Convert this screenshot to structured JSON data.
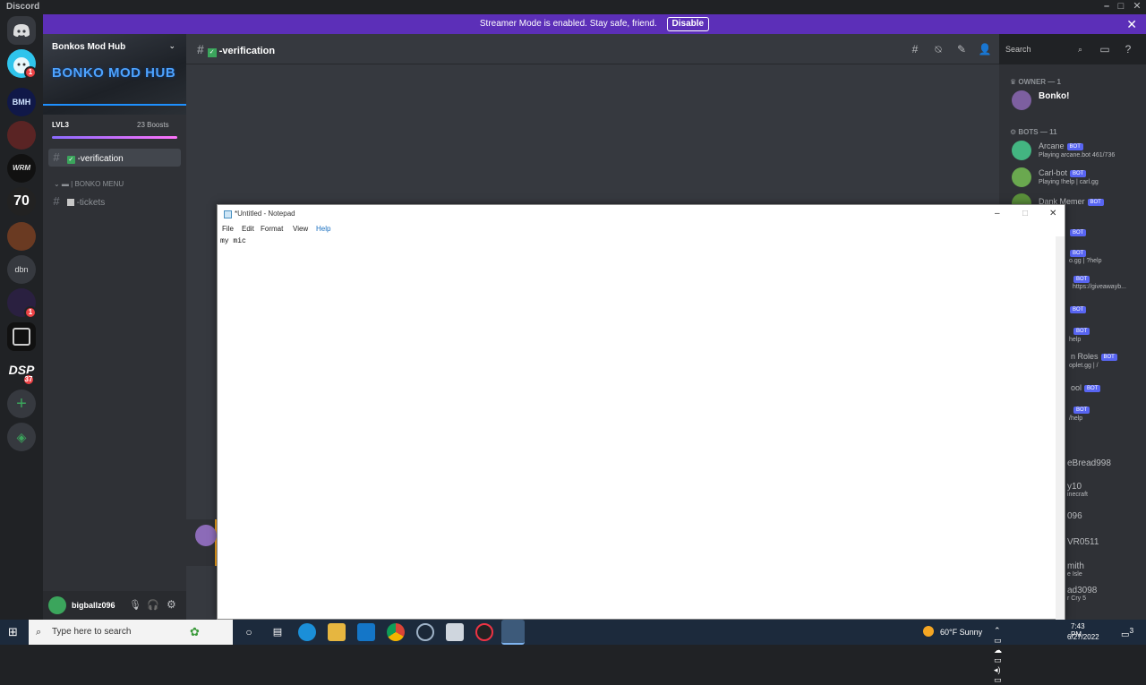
{
  "app": {
    "title": "Discord"
  },
  "streamer": {
    "message": "Streamer Mode is enabled. Stay safe, friend.",
    "button": "Disable"
  },
  "guilds": [
    {
      "label": "BMH",
      "badge": ""
    },
    {
      "label": "WRM",
      "badge": ""
    },
    {
      "label": "70",
      "badge": ""
    },
    {
      "label": "dbn",
      "badge": ""
    },
    {
      "label": "DSP",
      "badge": "37"
    }
  ],
  "guild_badges": {
    "second": "1",
    "purple": "1"
  },
  "server": {
    "name": "Bonkos Mod Hub",
    "banner_text": "BONKO MOD HUB",
    "level": "LVL3",
    "boosts": "23 Boosts",
    "active_channel": "-verification",
    "category": "| BONKO MENU",
    "channels": [
      "-tickets"
    ]
  },
  "chat": {
    "channel": "-verification",
    "search_placeholder": "Search"
  },
  "members": {
    "owner_cat": "OWNER — 1",
    "owner_name": "Bonko!",
    "bots_cat": "BOTS — 11",
    "bot_badge": "BOT",
    "bots": [
      {
        "name": "Arcane",
        "sub": "Playing arcane.bot 461/736"
      },
      {
        "name": "Carl-bot",
        "sub": "Playing !help | carl.gg"
      },
      {
        "name": "Dank Memer",
        "sub": ""
      }
    ],
    "partial": [
      "o.gg | ?help",
      "https://giveawayb...",
      "help",
      "n Roles",
      "oplet.gg | /",
      "ool",
      "/help",
      "eBread998",
      "y10",
      "inecraft",
      "096",
      "VR0511",
      "mith",
      "e Isle",
      "ad3098",
      "r Cry 5"
    ]
  },
  "user": {
    "name": "bigballz096"
  },
  "notepad": {
    "title": "*Untitled - Notepad",
    "menu": [
      "File",
      "Edit",
      "Format",
      "View",
      "Help"
    ],
    "text": "my mic"
  },
  "taskbar": {
    "search": "Type here to search",
    "weather": "60°F Sunny",
    "time": "7:43 PM",
    "date": "6/27/2022",
    "notif": "3"
  },
  "colors": {
    "blurple": "#5865f2",
    "streamer": "#5c2fb8",
    "online": "#3ba55c"
  }
}
